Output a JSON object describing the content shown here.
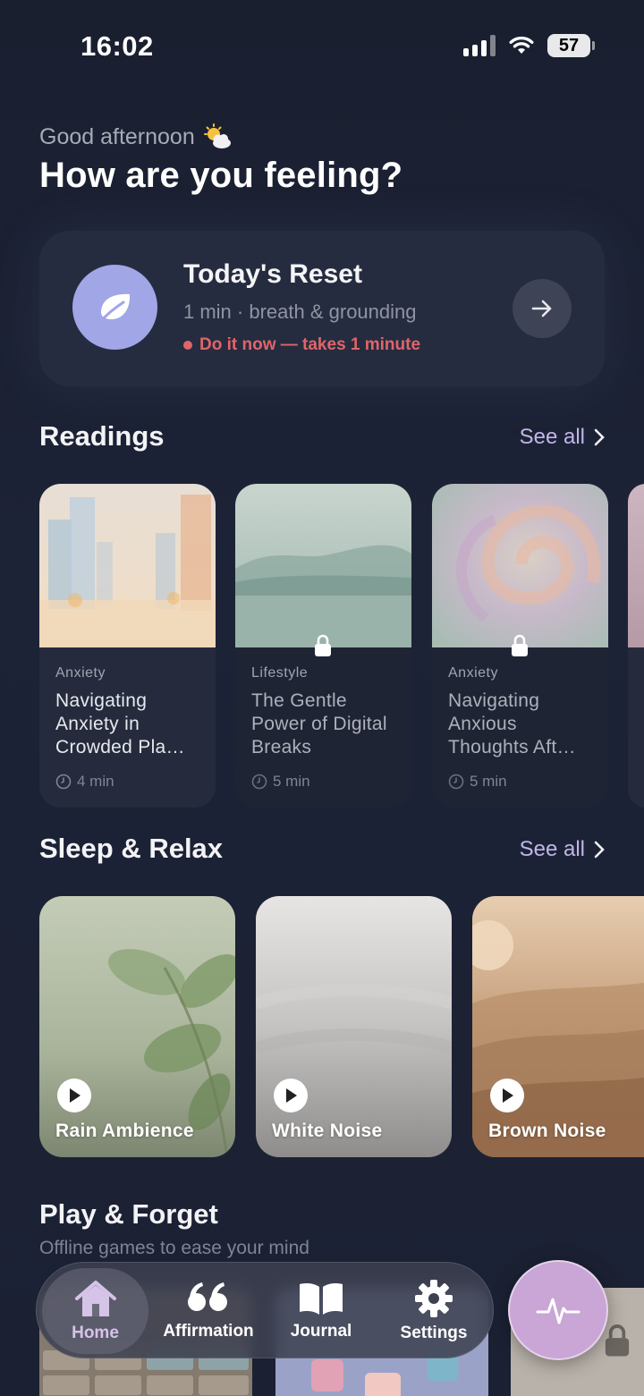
{
  "status_bar": {
    "time": "16:02",
    "battery": "57"
  },
  "header": {
    "greeting": "Good afternoon",
    "title": "How are you feeling?"
  },
  "reset": {
    "title": "Today's Reset",
    "subtitle": "1 min · breath & grounding",
    "cta": "Do it now — takes 1 minute",
    "accent": "#A0A6E6",
    "cta_color": "#E0656A"
  },
  "readings": {
    "title": "Readings",
    "see_all": "See all",
    "items": [
      {
        "category": "Anxiety",
        "title": "Navigating Anxiety in Crowded Pla…",
        "duration": "4 min",
        "locked": false
      },
      {
        "category": "Lifestyle",
        "title": "The Gentle Power of Digital Breaks",
        "duration": "5 min",
        "locked": true
      },
      {
        "category": "Anxiety",
        "title": "Navigating Anxious Thoughts Aft…",
        "duration": "5 min",
        "locked": true
      }
    ]
  },
  "sleep": {
    "title": "Sleep & Relax",
    "see_all": "See all",
    "items": [
      {
        "label": "Rain Ambience"
      },
      {
        "label": "White Noise"
      },
      {
        "label": "Brown Noise"
      }
    ]
  },
  "play": {
    "title": "Play & Forget",
    "subtitle": "Offline games to ease your mind"
  },
  "tabs": {
    "items": [
      {
        "label": "Home",
        "icon": "house-icon",
        "active": true
      },
      {
        "label": "Affirmation",
        "icon": "quote-icon",
        "active": false
      },
      {
        "label": "Journal",
        "icon": "book-icon",
        "active": false
      },
      {
        "label": "Settings",
        "icon": "gear-icon",
        "active": false
      }
    ],
    "fab_icon": "pulse-icon",
    "fab_color": "#C9A6D6"
  }
}
